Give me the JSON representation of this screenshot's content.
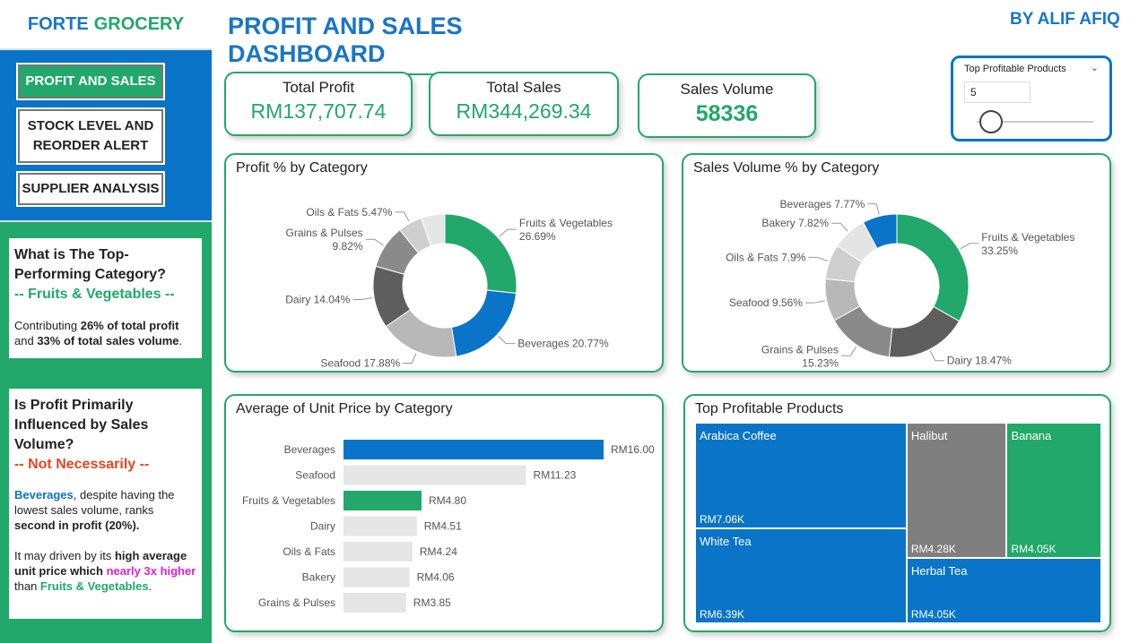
{
  "brand": {
    "part1": "FORTE",
    "part2": "GROCERY"
  },
  "nav": {
    "profit_sales": "PROFIT AND SALES",
    "stock_line1": "STOCK LEVEL AND",
    "stock_line2": "REORDER ALERT",
    "supplier": "SUPPLIER ANALYSIS"
  },
  "insight1": {
    "q_line1": "What is The Top-",
    "q_line2": "Performing Category?",
    "answer": "-- Fruits & Vegetables --",
    "t1": "Contributing ",
    "t2": "26% of total profit",
    "t3": " and ",
    "t4": "33% of total sales volume",
    "t5": "."
  },
  "insight2": {
    "q_line1": "Is Profit Primarily",
    "q_line2": "Influenced by Sales",
    "q_line3": "Volume?",
    "answer": "-- Not Necessarily --",
    "p1a": "Beverages",
    "p1b": ", despite having the lowest sales volume, ranks ",
    "p1c": "second in profit (20%).",
    "p2a": "It may driven by its ",
    "p2b": "high average unit price which ",
    "p2c": "nearly 3x higher",
    "p2d": " than ",
    "p2e": "Fruits & Vegetables",
    "p2f": "."
  },
  "header": {
    "title": "PROFIT AND SALES DASHBOARD",
    "author": "BY ALIF AFIQ"
  },
  "kpis": {
    "profit_label": "Total Profit",
    "profit_value": "RM137,707.74",
    "sales_label": "Total Sales",
    "sales_value": "RM344,269.34",
    "volume_label": "Sales Volume",
    "volume_value": "58336"
  },
  "slicer": {
    "title": "Top Profitable Products",
    "value": "5",
    "chevron": "chevron-down-icon",
    "fraction": 0.12
  },
  "colors": {
    "green": "#21a86a",
    "blue": "#0a74c8",
    "text_blue": "#1976c6"
  },
  "chart_data": [
    {
      "type": "pie",
      "title": "Profit % by Category",
      "slices": [
        {
          "label": "Fruits & Vegetables",
          "value": 26.69,
          "display": "26.69%",
          "color": "#21a86a"
        },
        {
          "label": "Beverages",
          "value": 20.77,
          "display": "20.77%",
          "color": "#0a74c8"
        },
        {
          "label": "Seafood",
          "value": 17.88,
          "display": "17.88%",
          "color": "#b8b8b8"
        },
        {
          "label": "Dairy",
          "value": 14.04,
          "display": "14.04%",
          "color": "#5e5e5e"
        },
        {
          "label": "Grains & Pulses",
          "value": 9.82,
          "display": "9.82%",
          "color": "#8a8a8a"
        },
        {
          "label": "Oils & Fats",
          "value": 5.47,
          "display": "5.47%",
          "color": "#cfcfcf"
        },
        {
          "label": "Other",
          "value": 5.33,
          "display": "",
          "color": "#e6e6e6"
        }
      ]
    },
    {
      "type": "pie",
      "title": "Sales Volume % by Category",
      "slices": [
        {
          "label": "Fruits & Vegetables",
          "value": 33.25,
          "display": "33.25%",
          "color": "#21a86a"
        },
        {
          "label": "Dairy",
          "value": 18.47,
          "display": "18.47%",
          "color": "#5e5e5e"
        },
        {
          "label": "Grains & Pulses",
          "value": 15.23,
          "display": "15.23%",
          "color": "#8a8a8a"
        },
        {
          "label": "Seafood",
          "value": 9.56,
          "display": "9.56%",
          "color": "#b8b8b8"
        },
        {
          "label": "Oils & Fats",
          "value": 7.9,
          "display": "7.9%",
          "color": "#cfcfcf"
        },
        {
          "label": "Bakery",
          "value": 7.82,
          "display": "7.82%",
          "color": "#e4e4e4"
        },
        {
          "label": "Beverages",
          "value": 7.77,
          "display": "7.77%",
          "color": "#0a74c8"
        }
      ]
    },
    {
      "type": "bar",
      "title": "Average of Unit Price by Category",
      "categories": [
        "Beverages",
        "Seafood",
        "Fruits & Vegetables",
        "Dairy",
        "Oils & Fats",
        "Bakery",
        "Grains & Pulses"
      ],
      "values": [
        16.0,
        11.23,
        4.8,
        4.51,
        4.24,
        4.06,
        3.85
      ],
      "labels": [
        "RM16.00",
        "RM11.23",
        "RM4.80",
        "RM4.51",
        "RM4.24",
        "RM4.06",
        "RM3.85"
      ],
      "colors": [
        "#0a74c8",
        "#e6e6e6",
        "#21a86a",
        "#e6e6e6",
        "#e6e6e6",
        "#e6e6e6",
        "#e6e6e6"
      ],
      "xlim": [
        0,
        16
      ]
    },
    {
      "type": "treemap",
      "title": "Top Profitable Products",
      "items": [
        {
          "name": "Arabica Coffee",
          "value": 7.06,
          "display": "RM7.06K",
          "color": "#0a74c8"
        },
        {
          "name": "White Tea",
          "value": 6.39,
          "display": "RM6.39K",
          "color": "#0a74c8"
        },
        {
          "name": "Halibut",
          "value": 4.28,
          "display": "RM4.28K",
          "color": "#7f7f7f"
        },
        {
          "name": "Banana",
          "value": 4.05,
          "display": "RM4.05K",
          "color": "#21a86a"
        },
        {
          "name": "Herbal Tea",
          "value": 4.05,
          "display": "RM4.05K",
          "color": "#0a74c8"
        }
      ]
    }
  ]
}
